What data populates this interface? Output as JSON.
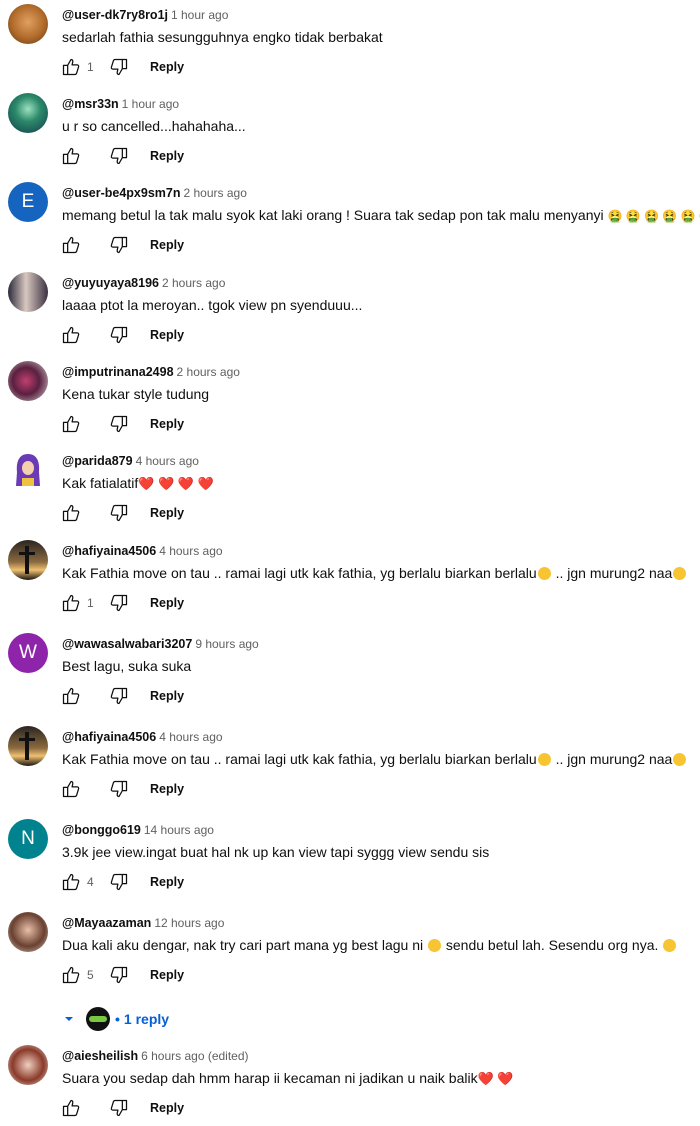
{
  "colors": {
    "link_blue": "#065fd4",
    "meta_gray": "#606060"
  },
  "comments": [
    {
      "author": "@user-dk7ry8ro1j",
      "time": "1 hour ago",
      "text": "sedarlah fathia sesungguhnya engko tidak berbakat",
      "likes": "1",
      "reply_label": "Reply",
      "avatar": "cat-photo-avatar"
    },
    {
      "author": "@msr33n",
      "time": "1 hour ago",
      "text": "u r so cancelled...hahahaha...",
      "likes": "",
      "reply_label": "Reply",
      "avatar": "landscape-photo-avatar"
    },
    {
      "author": "@user-be4px9sm7n",
      "time": "2 hours ago",
      "text": "memang betul la tak malu syok kat laki orang ! Suara tak sedap pon tak malu menyanyi",
      "emoji_suffix": "🤮 🤮 🤮 🤮 🤮 🤮",
      "likes": "",
      "reply_label": "Reply",
      "avatar_letter": "E",
      "avatar_color": "#1565c0"
    },
    {
      "author": "@yuyuyaya8196",
      "time": "2 hours ago",
      "text": "laaaa ptot la meroyan.. tgok view pn syenduuu...",
      "likes": "",
      "reply_label": "Reply",
      "avatar": "couple-photo-avatar"
    },
    {
      "author": "@imputrinana2498",
      "time": "2 hours ago",
      "text": "Kena tukar style tudung",
      "likes": "",
      "reply_label": "Reply",
      "avatar": "person-photo-avatar"
    },
    {
      "author": "@parida879",
      "time": "4 hours ago",
      "text": "Kak fatialatif",
      "emoji_suffix": "❤️ ❤️ ❤️ ❤️",
      "likes": "",
      "reply_label": "Reply",
      "avatar": "hijab-cartoon-avatar"
    },
    {
      "author": "@hafiyaina4506",
      "time": "4 hours ago",
      "text": "Kak Fathia move on tau .. ramai lagi utk kak fathia, yg berlalu biarkan berlalu",
      "text_mid": ".. jgn murung2 naa",
      "likes": "1",
      "reply_label": "Reply",
      "avatar": "sunset-cross-avatar"
    },
    {
      "author": "@wawasalwabari3207",
      "time": "9 hours ago",
      "text": "Best lagu, suka suka",
      "likes": "",
      "reply_label": "Reply",
      "avatar_letter": "W",
      "avatar_color": "#8e24aa"
    },
    {
      "author": "@hafiyaina4506",
      "time": "4 hours ago",
      "text": "Kak Fathia move on tau .. ramai lagi utk kak fathia, yg berlalu biarkan berlalu",
      "text_mid": ".. jgn murung2 naa",
      "likes": "",
      "reply_label": "Reply",
      "avatar": "sunset-cross-avatar"
    },
    {
      "author": "@bonggo619",
      "time": "14 hours ago",
      "text": "3.9k jee view.ingat buat hal nk up kan view tapi syggg view sendu sis",
      "likes": "4",
      "reply_label": "Reply",
      "avatar_letter": "N",
      "avatar_color": "#00838f"
    },
    {
      "author": "@Mayaazaman",
      "time": "12 hours ago",
      "text": "Dua kali aku dengar, nak try cari part mana yg best lagu ni",
      "text_mid": "sendu betul lah. Sesendu org nya.",
      "likes": "5",
      "reply_label": "Reply",
      "avatar": "woman-photo-avatar",
      "replies_label": "1 reply"
    },
    {
      "author": "@aiesheilish",
      "time": "6 hours ago (edited)",
      "text": "Suara you sedap dah hmm harap ii kecaman ni jadikan u naik balik",
      "emoji_suffix": "❤️ ❤️",
      "likes": "",
      "reply_label": "Reply",
      "avatar": "woman-glasses-avatar"
    }
  ]
}
